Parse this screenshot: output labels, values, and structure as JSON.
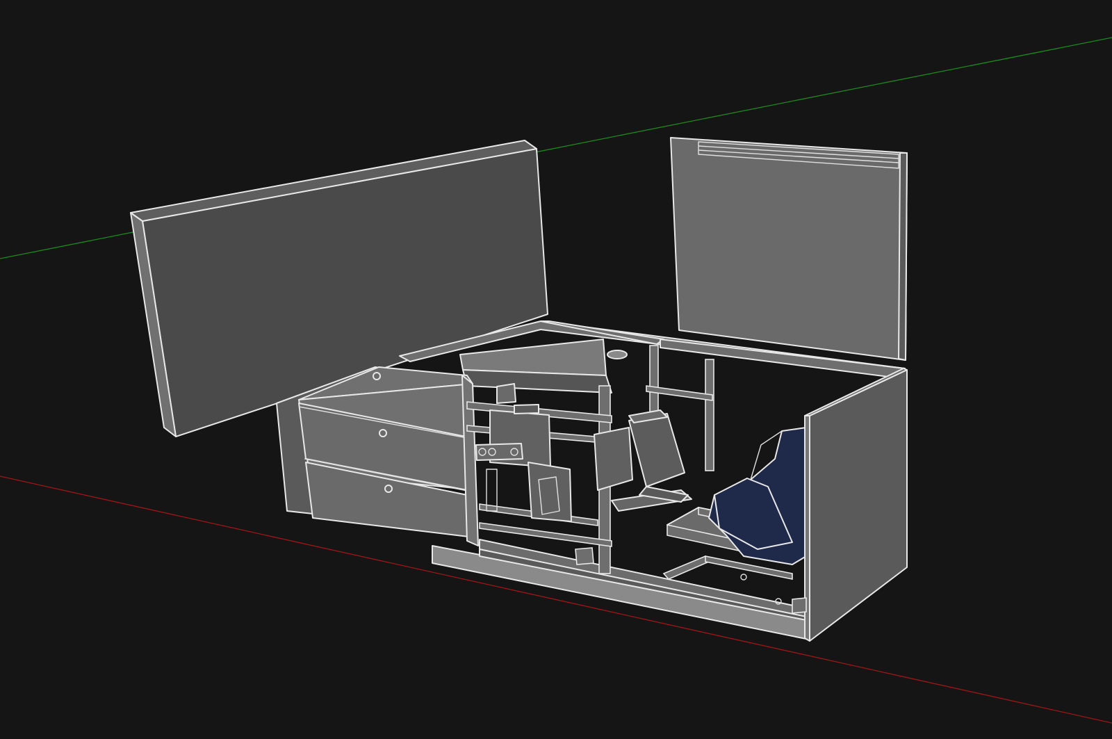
{
  "viewport": {
    "background_color": "#151515",
    "face_colors": {
      "light": "#707070",
      "mid": "#5e5e5e",
      "dark": "#4a4a4a",
      "edge": "#e8e8e8",
      "seat": "#1f2a4a"
    },
    "axes": [
      {
        "name": "green-axis",
        "color": "#1d8a1d"
      },
      {
        "name": "red-axis",
        "color": "#a01616"
      }
    ]
  }
}
